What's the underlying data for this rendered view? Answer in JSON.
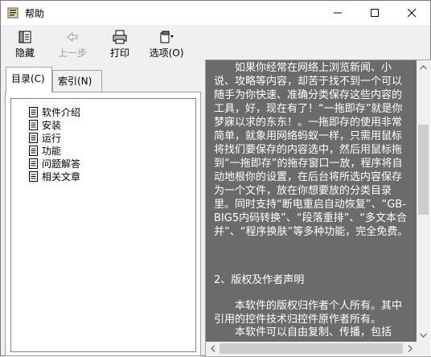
{
  "window": {
    "title": "帮助"
  },
  "toolbar": {
    "hide_label": "隐藏",
    "back_label": "上一步",
    "print_label": "打印",
    "options_label": "选项(O)"
  },
  "tabs": [
    {
      "label": "目录(C)"
    },
    {
      "label": "索引(N)"
    }
  ],
  "tree": [
    {
      "label": "软件介绍"
    },
    {
      "label": "安装"
    },
    {
      "label": "运行"
    },
    {
      "label": "功能"
    },
    {
      "label": "问题解答"
    },
    {
      "label": "相关文章"
    }
  ],
  "content": {
    "para1": "如果你经常在网络上浏览新闻、小说、攻略等内容，却苦于找不到一个可以随手为你快速、准确分类保存这些内容的工具，好，现在有了！“一拖即存”就是你梦寐以求的东东！。一拖即存的使用非常简单，就象用网络蚂蚁一样，只需用鼠标将找们要保存的内容选中，然后用鼠标拖到“一拖即存”的拖存窗口一放，程序将自动地根你的设置，在后台将所选内容保存为一个文件，放在你想要放的分类目录里。同时支持“断电重启自动恢复”、“GB-BIG5内码转换”、“段落重排”、“多文本合并”、“程序换肤”等多种功能，完全免费。",
    "heading2": "2、版权及作者声明",
    "para2": "本软件的版权归作者个人所有。其中引用的控件技术归控件原作者所有。",
    "para3": "本软件可以自由复制、传播，包括"
  }
}
